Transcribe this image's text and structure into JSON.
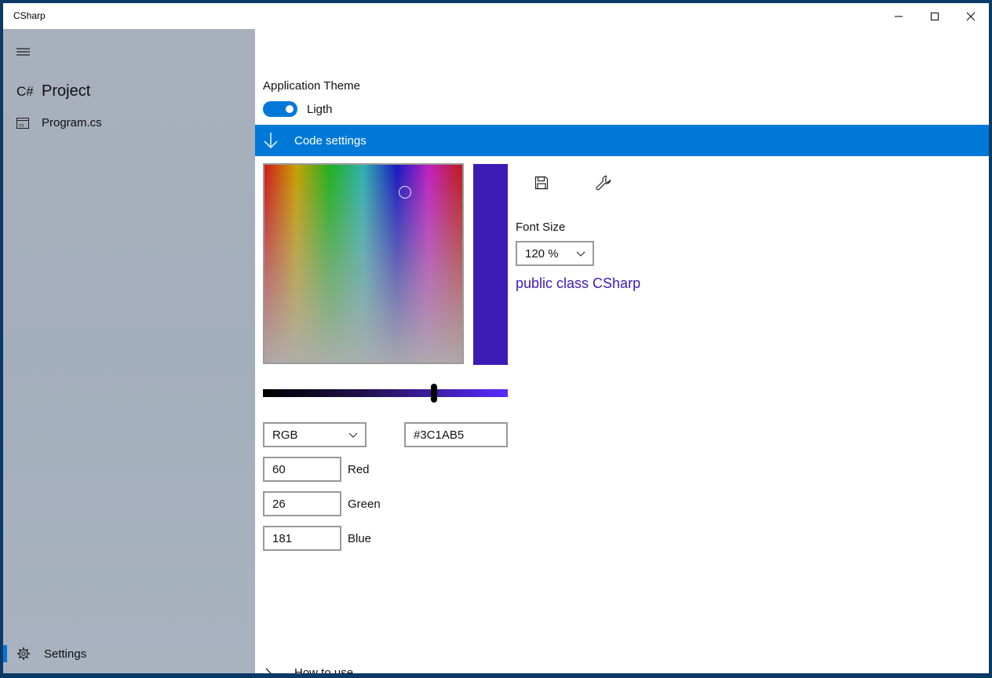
{
  "window": {
    "title": "CSharp"
  },
  "sidebar": {
    "project": {
      "glyph": "C#",
      "label": "Project"
    },
    "items": [
      {
        "label": "Program.cs"
      }
    ],
    "settings": {
      "label": "Settings"
    }
  },
  "main": {
    "theme": {
      "label": "Application Theme",
      "toggle_label": "Ligth",
      "toggle_on": true
    },
    "expander": {
      "label": "Code settings"
    },
    "color_picker": {
      "preview_color": "#3C1AB5",
      "value_level": 0.7,
      "model_select": {
        "value": "RGB"
      },
      "hex": {
        "value": "#3C1AB5"
      },
      "channels": [
        {
          "value": "60",
          "label": "Red"
        },
        {
          "value": "26",
          "label": "Green"
        },
        {
          "value": "181",
          "label": "Blue"
        }
      ]
    },
    "font_size": {
      "label": "Font Size",
      "value": "120 %"
    },
    "code_preview": {
      "text": "public class CSharp",
      "color": "#3C1AB5"
    },
    "how_to_use": {
      "label": "How to use"
    }
  },
  "colors": {
    "accent": "#0078d7"
  },
  "icons": {
    "hamburger": "hamburger-icon",
    "file": "code-file-icon",
    "settings": "gear-icon",
    "expander": "arrow-down-icon",
    "save": "save-icon",
    "wrench": "wrench-icon"
  }
}
